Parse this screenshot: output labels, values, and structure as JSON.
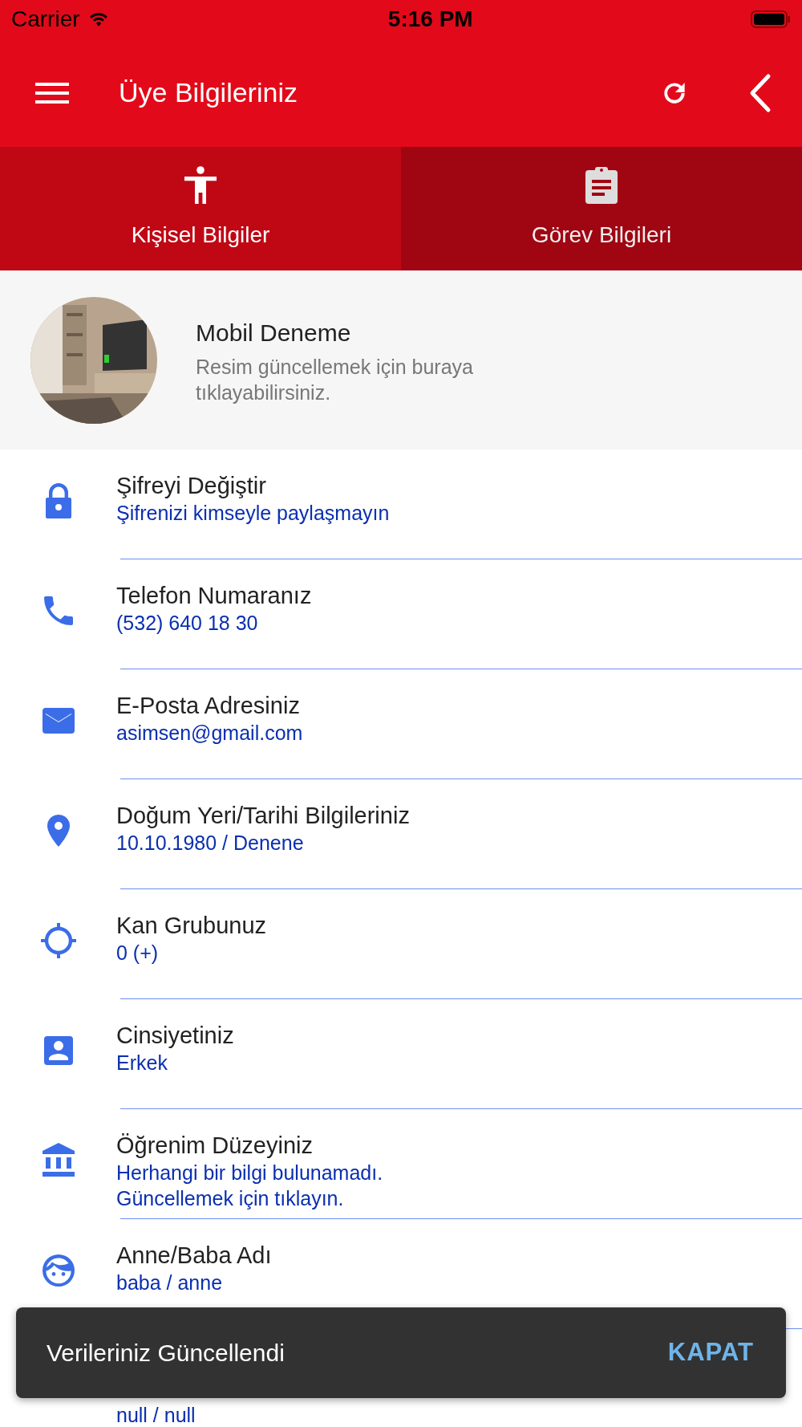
{
  "status_bar": {
    "carrier": "Carrier",
    "time": "5:16 PM"
  },
  "header": {
    "title": "Üye Bilgileriniz"
  },
  "tabs": [
    {
      "label": "Kişisel Bilgiler",
      "selected": true
    },
    {
      "label": "Görev Bilgileri",
      "selected": false
    }
  ],
  "profile": {
    "name": "Mobil Deneme",
    "hint": "Resim güncellemek için buraya tıklayabilirsiniz."
  },
  "rows": [
    {
      "title": "Şifreyi Değiştir",
      "value": "Şifrenizi kimseyle paylaşmayın"
    },
    {
      "title": "Telefon Numaranız",
      "value": "(532) 640 18 30"
    },
    {
      "title": "E-Posta Adresiniz",
      "value": "asimsen@gmail.com"
    },
    {
      "title": "Doğum Yeri/Tarihi Bilgileriniz",
      "value": "10.10.1980 / Denene"
    },
    {
      "title": "Kan Grubunuz",
      "value": "0 (+)"
    },
    {
      "title": "Cinsiyetiniz",
      "value": "Erkek"
    },
    {
      "title": "Öğrenim Düzeyiniz",
      "value": "Herhangi bir bilgi bulunamadı. Güncellemek için tıklayın."
    },
    {
      "title": "Anne/Baba Adı",
      "value": "baba / anne"
    },
    {
      "value": "null / null"
    }
  ],
  "snackbar": {
    "message": "Verileriniz Güncellendi",
    "action": "KAPAT"
  }
}
